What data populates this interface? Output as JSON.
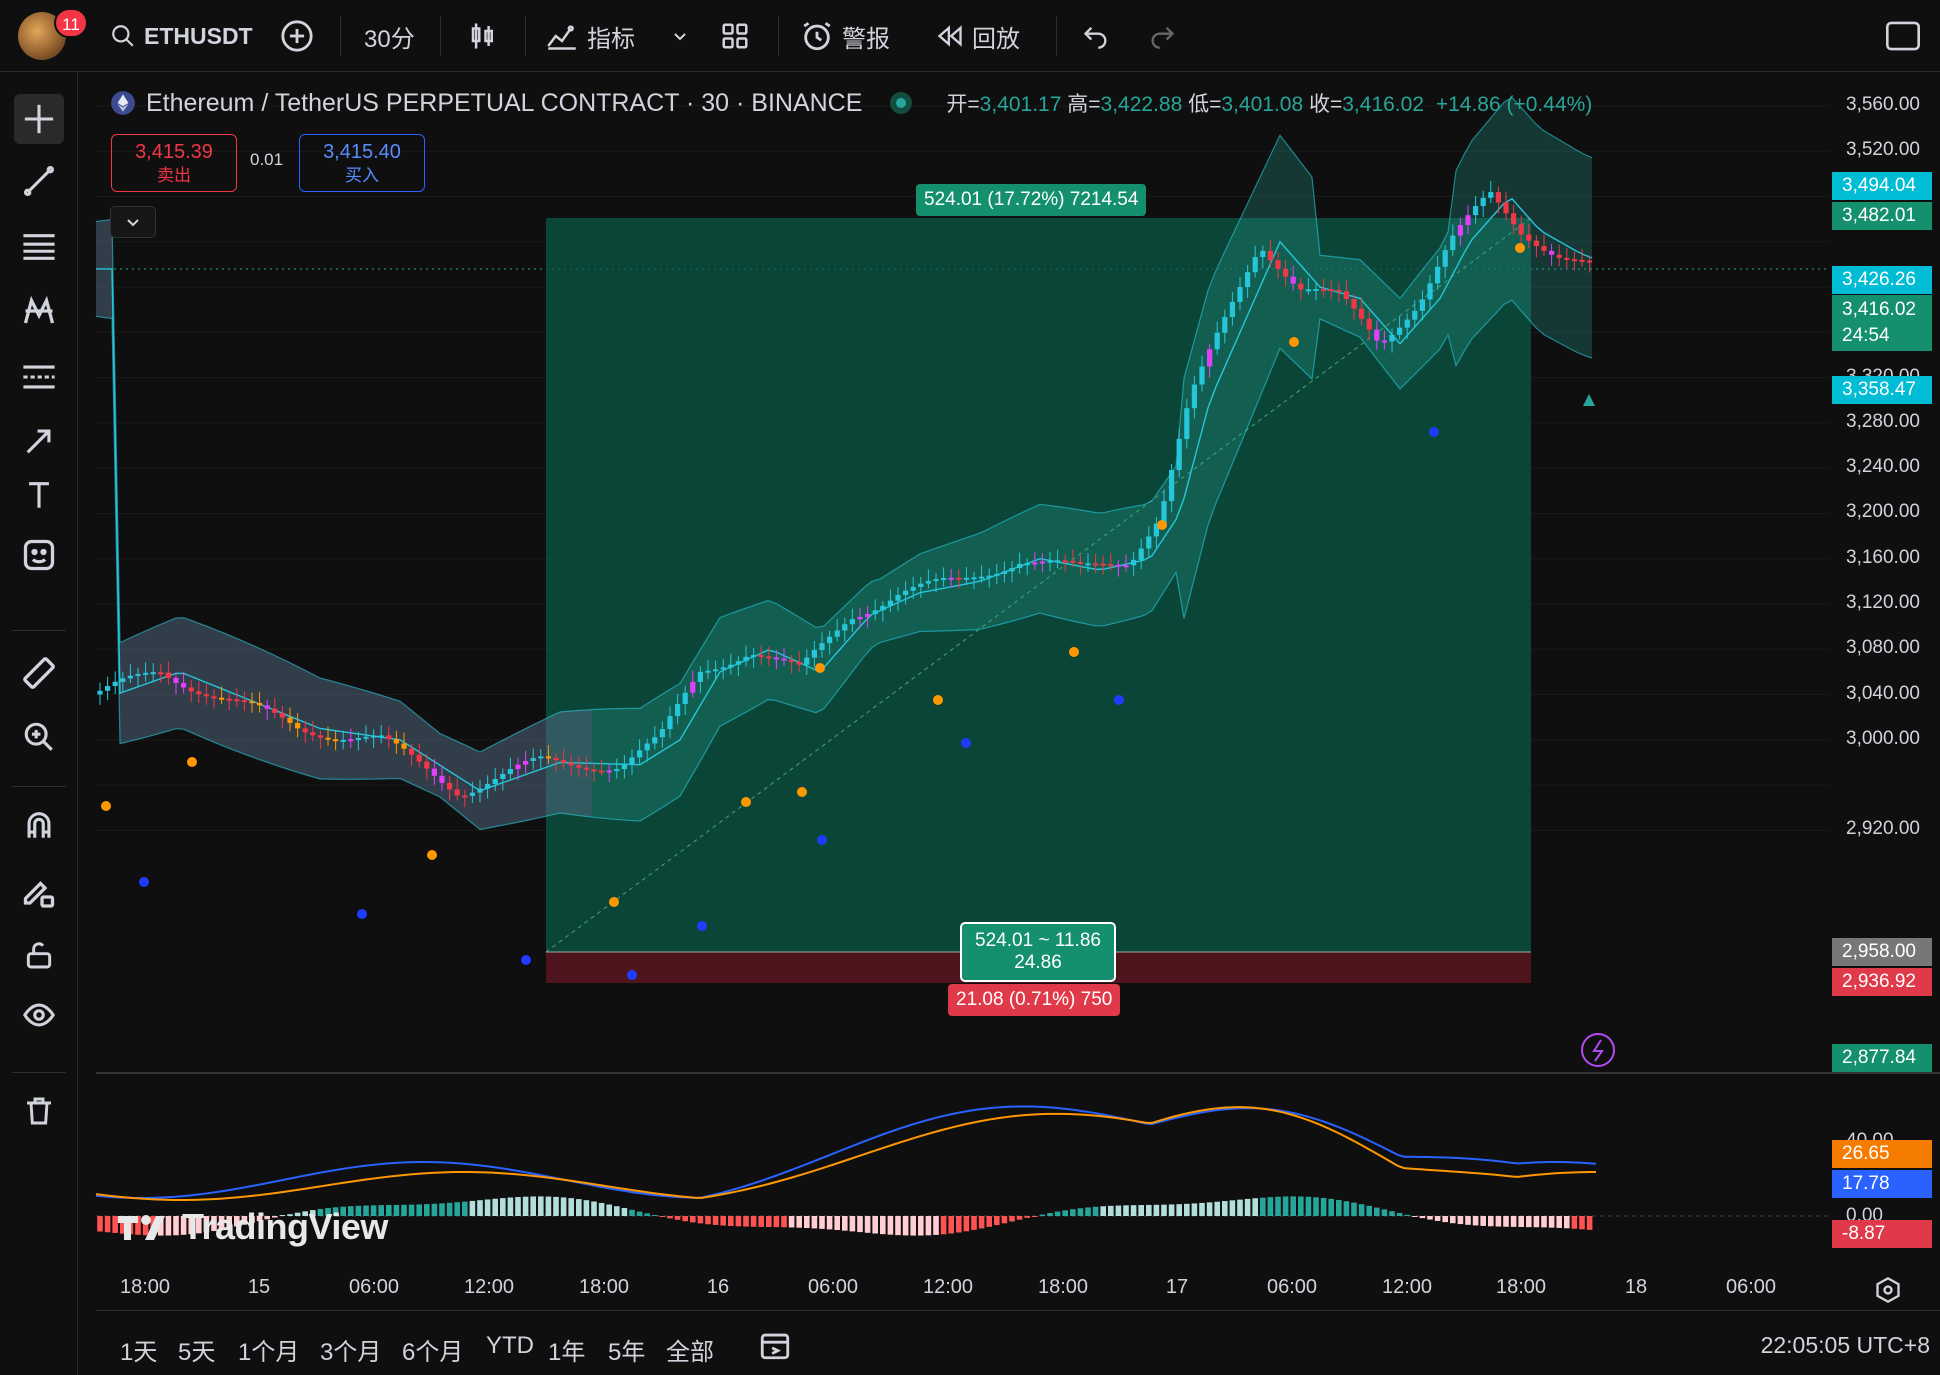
{
  "topbar": {
    "badge": "11",
    "symbol": "ETHUSDT",
    "interval": "30分",
    "indicators": "指标",
    "alert": "警报",
    "replay": "回放"
  },
  "legend": {
    "title": "Ethereum / TetherUS PERPETUAL CONTRACT · 30 · BINANCE",
    "open_label": "开=",
    "open": "3,401.17",
    "high_label": "高=",
    "high": "3,422.88",
    "low_label": "低=",
    "low": "3,401.08",
    "close_label": "收=",
    "close": "3,416.02",
    "change": "+14.86 (+0.44%)"
  },
  "trade": {
    "sell_price": "3,415.39",
    "sell_label": "卖出",
    "spread": "0.01",
    "buy_price": "3,415.40",
    "buy_label": "买入"
  },
  "position": {
    "target_label": "524.01 (17.72%) 7214.54",
    "center_line1": "524.01 ~ 11.86",
    "center_line2": "24.86",
    "stop_label": "21.08 (0.71%) 750"
  },
  "price_axis": [
    "3,560.00",
    "3,520.00",
    "3,320.00",
    "3,280.00",
    "3,240.00",
    "3,200.00",
    "3,160.00",
    "3,120.00",
    "3,080.00",
    "3,040.00",
    "3,000.00",
    "2,920.00"
  ],
  "price_tags": {
    "p3494": "3,494.04",
    "p3482": "3,482.01",
    "p3426": "3,426.26",
    "p3416": "3,416.02",
    "countdown": "24:54",
    "p3358": "3,358.47",
    "p2958": "2,958.00",
    "p2936": "2,936.92",
    "p2877": "2,877.84"
  },
  "macd_axis": {
    "top": "40.00",
    "zero": "0.00"
  },
  "macd_tags": {
    "signal": "26.65",
    "macd": "17.78",
    "hist": "-8.87"
  },
  "time_axis": [
    "18:00",
    "15",
    "06:00",
    "12:00",
    "18:00",
    "16",
    "06:00",
    "12:00",
    "18:00",
    "17",
    "06:00",
    "12:00",
    "18:00",
    "18",
    "06:00"
  ],
  "watermark": "TradingView",
  "ranges": [
    "1天",
    "5天",
    "1个月",
    "3个月",
    "6个月",
    "YTD",
    "1年",
    "5年",
    "全部"
  ],
  "clock": "22:05:05 UTC+8",
  "colors": {
    "up": "#26a69a",
    "down": "#f23645",
    "teal": "#00bcd4",
    "orange": "#ff9800",
    "blue": "#2962ff"
  }
}
